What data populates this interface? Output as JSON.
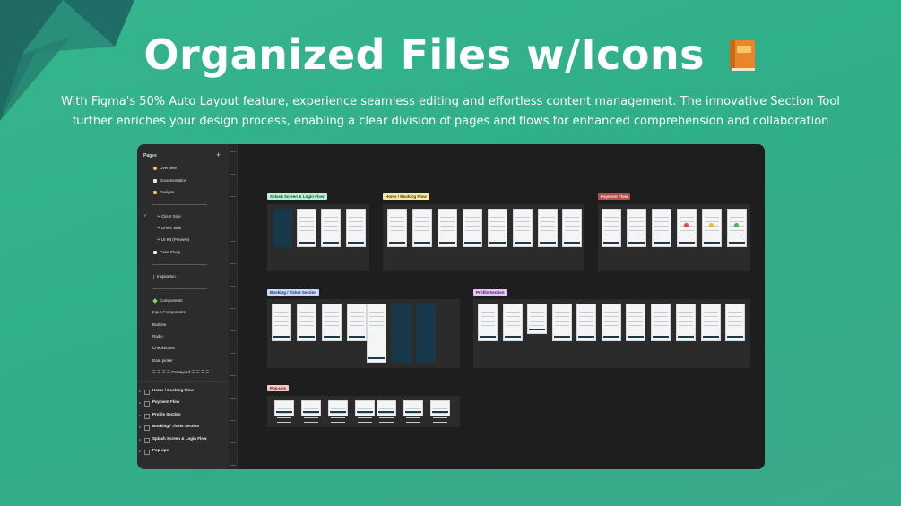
{
  "hero": {
    "title": "Organized Files w/Icons",
    "book_icon": "orange-book-icon",
    "subtitle_line1": "With Figma's 50% Auto Layout feature, experience seamless editing and effortless content management. The innovative Section Tool",
    "subtitle_line2": "further enriches your design process, enabling a clear division of pages and flows for enhanced comprehension and collaboration"
  },
  "colors": {
    "background": "#36b58e",
    "window_bg": "#1e1e1e",
    "sidebar_bg": "#2c2c2c",
    "tag_green": "#b9f2d4",
    "tag_yellow": "#f6e7a4",
    "tag_red": "#b5504a",
    "tag_blue": "#c9d9f7",
    "tag_purple": "#e3c9f4",
    "tag_pink": "#f7c7c3"
  },
  "sidebar": {
    "title": "Pages",
    "add_icon": "plus-icon",
    "pages": [
      {
        "label": "Overview",
        "icon": "yellow-dot-icon"
      },
      {
        "label": "Documentation",
        "icon": "document-icon"
      },
      {
        "label": "Designs",
        "icon": "thumbs-up-icon"
      },
      {
        "label": "↪ Client Side",
        "icon": "none",
        "checked": true
      },
      {
        "label": "↪ Driver Side",
        "icon": "none"
      },
      {
        "label": "↪ UI Kit (Preview)",
        "icon": "none"
      },
      {
        "label": "Case Study",
        "icon": "book-icon"
      },
      {
        "label": "Inspiration",
        "icon": "pin-icon"
      },
      {
        "label": "Components",
        "icon": "component-icon"
      },
      {
        "label": "Input Components",
        "icon": "none"
      },
      {
        "label": "Buttons",
        "icon": "none"
      },
      {
        "label": "Radio",
        "icon": "none"
      },
      {
        "label": "Checkboxes",
        "icon": "none"
      },
      {
        "label": "Date picker",
        "icon": "none"
      },
      {
        "label": "☰ ☰ ☰ ☰ Graveyard ☰ ☰ ☰ ☰",
        "icon": "none"
      }
    ],
    "layers": [
      "Home / Booking Flow",
      "Payment Flow",
      "Profile Section",
      "Booking / Ticket Section",
      "Splash Screen & Login Flow",
      "Pop-ups"
    ]
  },
  "canvas": {
    "sections": [
      {
        "label": "Splash Screen & Login Flow",
        "color": "#b9f2d4"
      },
      {
        "label": "Home / Booking Flow",
        "color": "#f6e7a4"
      },
      {
        "label": "Payment Flow",
        "color": "#b5504a"
      },
      {
        "label": "Booking / Ticket Section",
        "color": "#c9d9f7"
      },
      {
        "label": "Profile Section",
        "color": "#e3c9f4"
      },
      {
        "label": "Pop-ups",
        "color": "#f7c7c3"
      }
    ]
  }
}
